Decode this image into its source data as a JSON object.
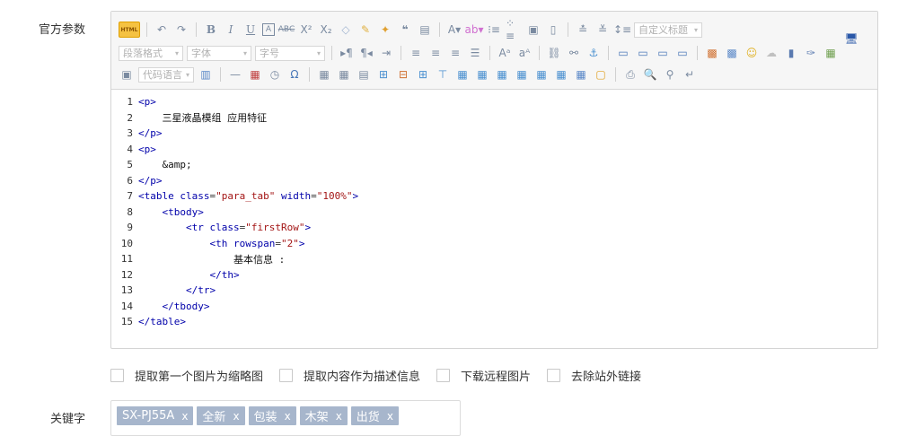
{
  "form": {
    "official_params_label": "官方参数",
    "keywords_label": "关键字"
  },
  "toolbar": {
    "html_button_label": "HTML",
    "paragraph_format": "段落格式",
    "font_family": "字体",
    "font_size": "字号",
    "custom_title": "自定义标题",
    "code_language": "代码语言"
  },
  "code_lines": [
    {
      "num": "1",
      "text": "<p>"
    },
    {
      "num": "2",
      "text": "    三星液晶模组 应用特征"
    },
    {
      "num": "3",
      "text": "</p>"
    },
    {
      "num": "4",
      "text": "<p>"
    },
    {
      "num": "5",
      "text": "    &amp;"
    },
    {
      "num": "6",
      "text": "</p>"
    },
    {
      "num": "7",
      "text": "<table class=\"para_tab\" width=\"100%\">"
    },
    {
      "num": "8",
      "text": "    <tbody>"
    },
    {
      "num": "9",
      "text": "        <tr class=\"firstRow\">"
    },
    {
      "num": "10",
      "text": "            <th rowspan=\"2\">"
    },
    {
      "num": "11",
      "text": "                基本信息 :"
    },
    {
      "num": "12",
      "text": "            </th>"
    },
    {
      "num": "13",
      "text": "        </tr>"
    },
    {
      "num": "14",
      "text": "    </tbody>"
    },
    {
      "num": "15",
      "text": "</table>"
    }
  ],
  "options": [
    {
      "label": "提取第一个图片为缩略图",
      "checked": false
    },
    {
      "label": "提取内容作为描述信息",
      "checked": false
    },
    {
      "label": "下载远程图片",
      "checked": false
    },
    {
      "label": "去除站外链接",
      "checked": false
    }
  ],
  "keywords": [
    "SX-PJ55A",
    "全新",
    "包装",
    "木架",
    "出货"
  ],
  "keyword_remove_glyph": "x"
}
